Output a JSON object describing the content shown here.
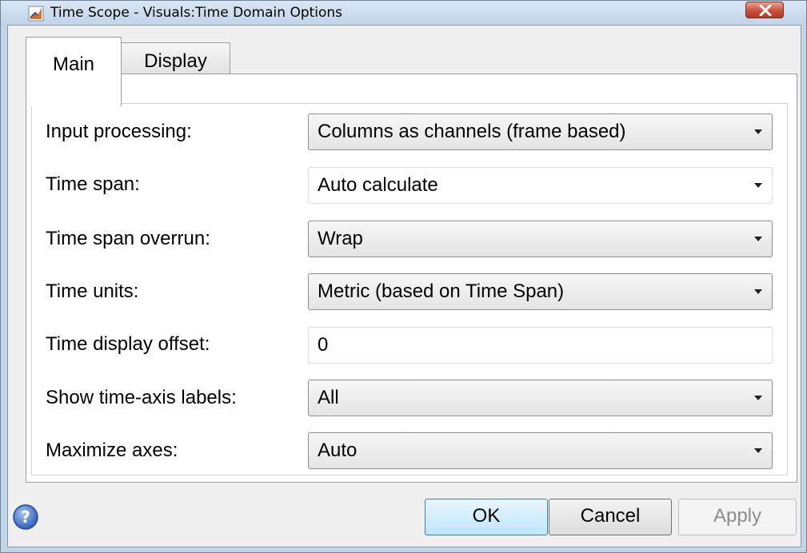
{
  "window": {
    "title": "Time Scope - Visuals:Time Domain Options"
  },
  "tabs": [
    {
      "label": "Main",
      "selected": true
    },
    {
      "label": "Display",
      "selected": false
    }
  ],
  "fields": [
    {
      "label": "Input processing:",
      "value": "Columns as channels (frame based)",
      "control": "dropdown"
    },
    {
      "label": "Time span:",
      "value": "Auto calculate",
      "control": "editable-dropdown"
    },
    {
      "label": "Time span overrun:",
      "value": "Wrap",
      "control": "dropdown"
    },
    {
      "label": "Time units:",
      "value": "Metric (based on Time Span)",
      "control": "dropdown"
    },
    {
      "label": "Time display offset:",
      "value": "0",
      "control": "text"
    },
    {
      "label": "Show time-axis labels:",
      "value": "All",
      "control": "dropdown"
    },
    {
      "label": "Maximize axes:",
      "value": "Auto",
      "control": "dropdown"
    }
  ],
  "buttons": {
    "ok": "OK",
    "cancel": "Cancel",
    "apply": "Apply"
  },
  "icons": {
    "app": "matlab-app-icon",
    "close": "close-icon",
    "help": "help-icon"
  },
  "colors": {
    "titlebar": "#c5d5e8",
    "close_button": "#c9503c",
    "default_button": "#bee6fd",
    "disabled_text": "#8d8d8d"
  }
}
